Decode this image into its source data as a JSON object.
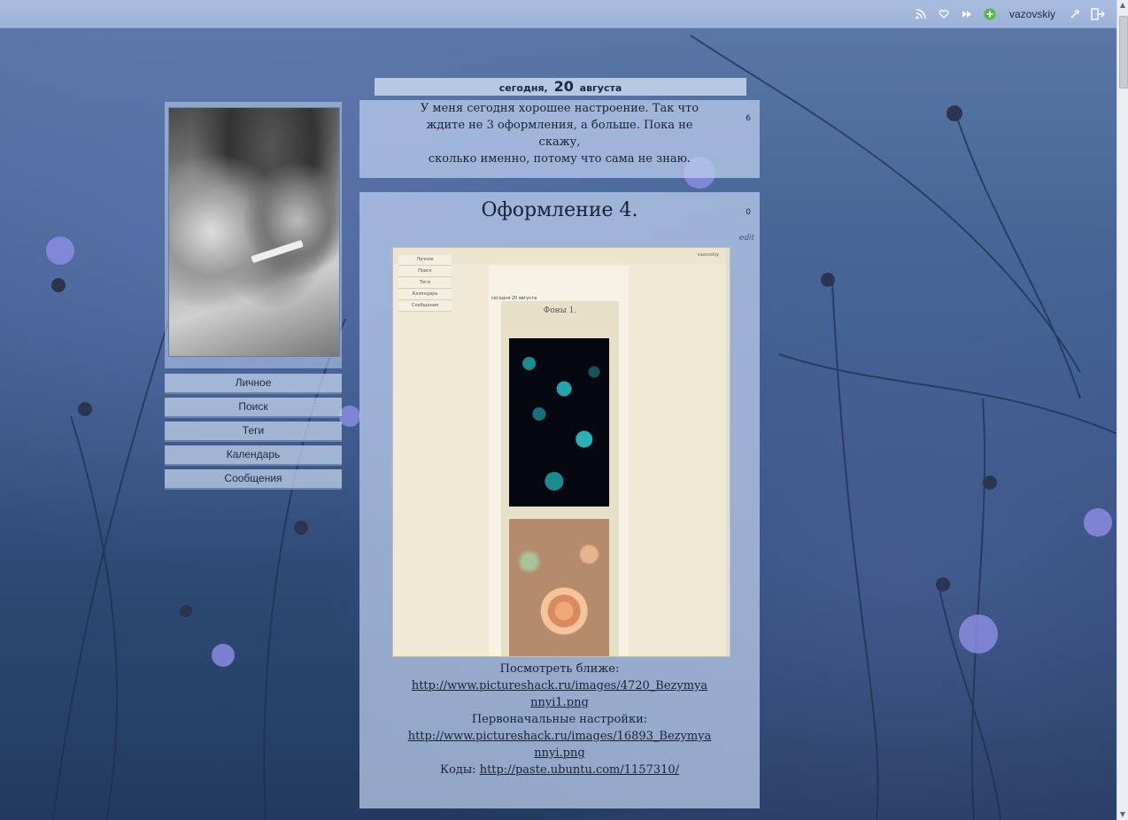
{
  "topbar": {
    "username": "vazovskiy",
    "icons": [
      "rss-icon",
      "heart-icon",
      "fast-forward-icon",
      "add-icon",
      "settings-icon",
      "logout-icon"
    ]
  },
  "sidebar": {
    "items": [
      {
        "label": "Личное"
      },
      {
        "label": "Поиск"
      },
      {
        "label": "Теги"
      },
      {
        "label": "Календарь"
      },
      {
        "label": "Сообщения"
      }
    ]
  },
  "date_header": {
    "prefix": "сегодня,",
    "day": "20",
    "month": "августа"
  },
  "posts": [
    {
      "text_lines": [
        "У меня сегодня хорошее настроение. Так что",
        "ждите не 3 оформления, а больше. Пока не скажу,",
        "сколько именно, потому что сама не знаю."
      ],
      "comment_count": "6"
    },
    {
      "title": "Оформление 4.",
      "comment_count": "0",
      "edit_label": "edit",
      "preview": {
        "username": "vazovskiy",
        "nav": [
          "Личное",
          "Поиск",
          "Теги",
          "Календарь",
          "Сообщения"
        ],
        "date": "сегодня 20 августа",
        "title": "Фоны 1."
      },
      "lines": [
        {
          "text": "Посмотреть ближе:"
        },
        {
          "link": "http://www.pictureshack.ru/images/4720_Bezymya",
          "link2": "nnyi1.png"
        },
        {
          "text": "Первоначальные настройки:"
        },
        {
          "link": "http://www.pictureshack.ru/images/16893_Bezymya",
          "link2": "nnyi.png"
        },
        {
          "label": "Коды:",
          "link": "http://paste.ubuntu.com/1157310/"
        }
      ]
    }
  ],
  "colors": {
    "accent_panel": "#bed0ee",
    "add_icon": "#4fbf3a"
  }
}
